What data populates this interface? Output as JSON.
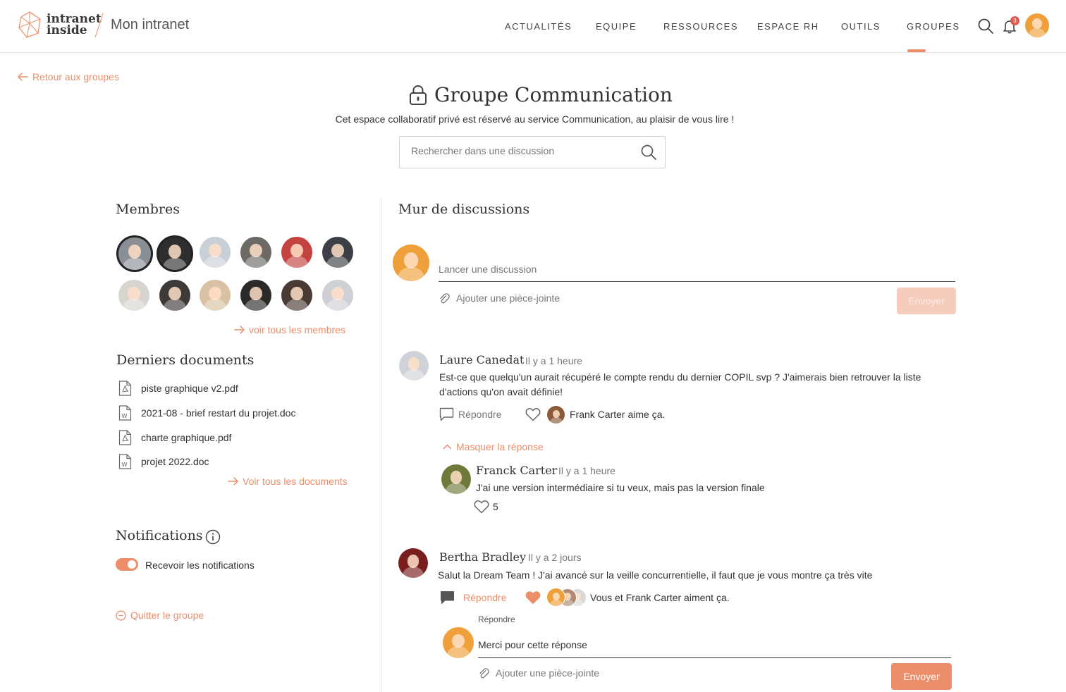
{
  "header": {
    "logo_line1": "intranet",
    "logo_line2": "inside",
    "site_name": "Mon intranet",
    "nav": [
      {
        "label": "ACTUALITÉS"
      },
      {
        "label": "EQUIPE"
      },
      {
        "label": "RESSOURCES"
      },
      {
        "label": "ESPACE RH"
      },
      {
        "label": "OUTILS"
      },
      {
        "label": "GROUPES",
        "active": true
      }
    ],
    "notification_count": "3",
    "icons": {
      "search": "search-icon",
      "bell": "bell-icon"
    }
  },
  "back_link": "Retour aux groupes",
  "group": {
    "title": "Groupe Communication",
    "description": "Cet espace collaboratif privé est réservé au service Communication, au plaisir de vous lire !",
    "search_placeholder": "Rechercher dans une discussion"
  },
  "members": {
    "title": "Membres",
    "see_all": "voir tous les membres"
  },
  "documents": {
    "title": "Derniers documents",
    "items": [
      {
        "name": "piste graphique v2.pdf",
        "type": "pdf"
      },
      {
        "name": "2021-08 - brief restart du projet.doc",
        "type": "doc"
      },
      {
        "name": "charte graphique.pdf",
        "type": "pdf"
      },
      {
        "name": "projet 2022.doc",
        "type": "doc"
      }
    ],
    "see_all": "Voir tous les documents"
  },
  "notifications": {
    "title": "Notifications",
    "toggle_label": "Recevoir les notifications",
    "enabled": true
  },
  "leave_group": "Quitter le groupe",
  "wall": {
    "title": "Mur de discussions",
    "new_placeholder": "Lancer une discussion",
    "attach_label": "Ajouter une pièce-jointe",
    "send_label": "Envoyer",
    "posts": [
      {
        "author": "Laure Canedat",
        "time": "Il y a 1 heure",
        "text": "Est-ce que quelqu'un aurait récupéré le compte rendu du dernier COPIL svp ? J'aimerais bien retrouver la liste d'actions qu'on avait définie!",
        "reply_label": "Répondre",
        "likes_text": "Frank Carter aime ça.",
        "hide_replies": "Masquer la réponse",
        "replies": [
          {
            "author": "Franck Carter",
            "time": "Il y a 1 heure",
            "text": "J'ai une version intermédiaire si tu veux, mais pas la version finale",
            "likes": "5"
          }
        ]
      },
      {
        "author": "Bertha Bradley",
        "time": "Il y a 2 jours",
        "text": "Salut la Dream Team ! J'ai avancé sur la veille concurrentielle, il faut que je vous montre ça très vite",
        "reply_label": "Répondre",
        "likes_text": "Vous et Frank Carter aiment ça.",
        "reply_box": {
          "label": "Répondre",
          "value": "Merci pour cette réponse",
          "attach_label": "Ajouter une pièce-jointe",
          "send_label": "Envoyer"
        }
      }
    ]
  },
  "colors": {
    "accent": "#ec8e6a",
    "accent_light": "#f6cdbd",
    "text": "#333333",
    "muted": "#777777"
  }
}
